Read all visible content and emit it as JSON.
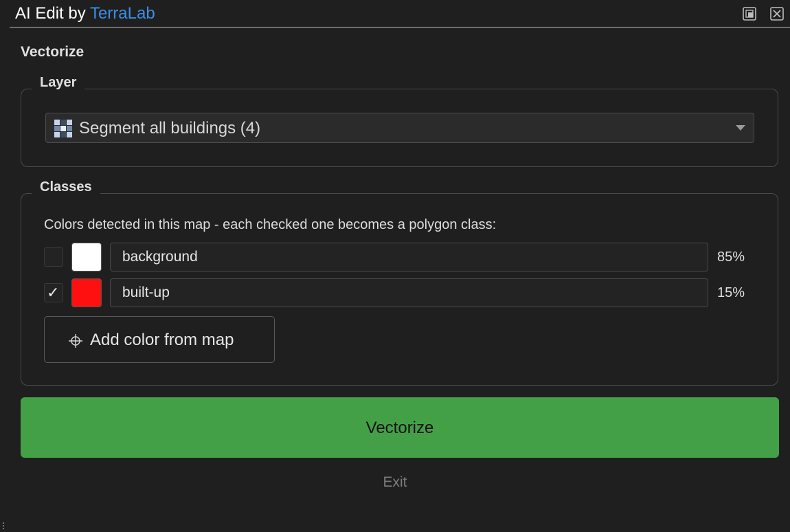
{
  "window": {
    "title_prefix": "AI Edit by ",
    "title_brand": "TerraLab"
  },
  "heading": "Vectorize",
  "layer_group": {
    "title": "Layer",
    "selected_value": "Segment all buildings (4)"
  },
  "classes_group": {
    "title": "Classes",
    "description": "Colors detected in this map - each checked one becomes a polygon class:",
    "rows": [
      {
        "name": "background",
        "percent": "85%",
        "color": "#ffffff",
        "checked": false
      },
      {
        "name": "built-up",
        "percent": "15%",
        "color": "#ff1010",
        "checked": true
      }
    ],
    "add_color_label": "Add color from map"
  },
  "actions": {
    "vectorize_label": "Vectorize",
    "exit_label": "Exit"
  },
  "colors": {
    "brand": "#3a8fe6",
    "primary_button": "#43a047",
    "background": "#1f1f1f"
  },
  "icons": {
    "float": "float-window-icon",
    "close": "close-icon",
    "layer": "raster-layer-icon",
    "dropdown": "chevron-down-icon",
    "add_color": "crosshair-icon",
    "check": "checkmark-icon"
  }
}
